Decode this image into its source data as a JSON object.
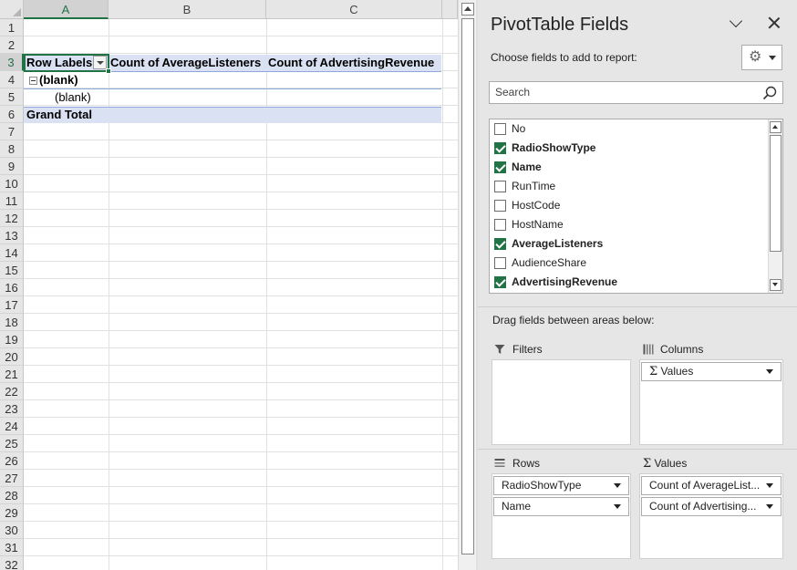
{
  "sheet": {
    "columns": [
      "A",
      "B",
      "C"
    ],
    "rows": [
      "1",
      "2",
      "3",
      "4",
      "5",
      "6",
      "7",
      "8",
      "9",
      "10",
      "11",
      "12",
      "13",
      "14",
      "15",
      "16",
      "17",
      "18",
      "19",
      "20",
      "21",
      "22",
      "23",
      "24",
      "25",
      "26",
      "27",
      "28",
      "29",
      "30",
      "31",
      "32"
    ],
    "pivot": {
      "row_labels_header": "Row Labels",
      "col_b_header": "Count of AverageListeners",
      "col_c_header": "Count of AdvertisingRevenue",
      "group_label": "(blank)",
      "item_label": "(blank)",
      "grand_total": "Grand Total"
    }
  },
  "panel": {
    "title": "PivotTable Fields",
    "subtitle": "Choose fields to add to report:",
    "search_placeholder": "Search",
    "fields": [
      {
        "name": "No",
        "checked": false
      },
      {
        "name": "RadioShowType",
        "checked": true
      },
      {
        "name": "Name",
        "checked": true
      },
      {
        "name": "RunTime",
        "checked": false
      },
      {
        "name": "HostCode",
        "checked": false
      },
      {
        "name": "HostName",
        "checked": false
      },
      {
        "name": "AverageListeners",
        "checked": true
      },
      {
        "name": "AudienceShare",
        "checked": false
      },
      {
        "name": "AdvertisingRevenue",
        "checked": true
      }
    ],
    "drag_text": "Drag fields between areas below:",
    "areas": {
      "filters": {
        "label": "Filters"
      },
      "columns": {
        "label": "Columns",
        "items": [
          "Values"
        ]
      },
      "rows": {
        "label": "Rows",
        "items": [
          "RadioShowType",
          "Name"
        ]
      },
      "values": {
        "label": "Values",
        "items": [
          "Count of AverageList...",
          "Count of Advertising..."
        ]
      }
    },
    "sigma_glyph": "Σ"
  },
  "colors": {
    "excel_green": "#217346",
    "pivot_band": "#d9e1f2"
  }
}
